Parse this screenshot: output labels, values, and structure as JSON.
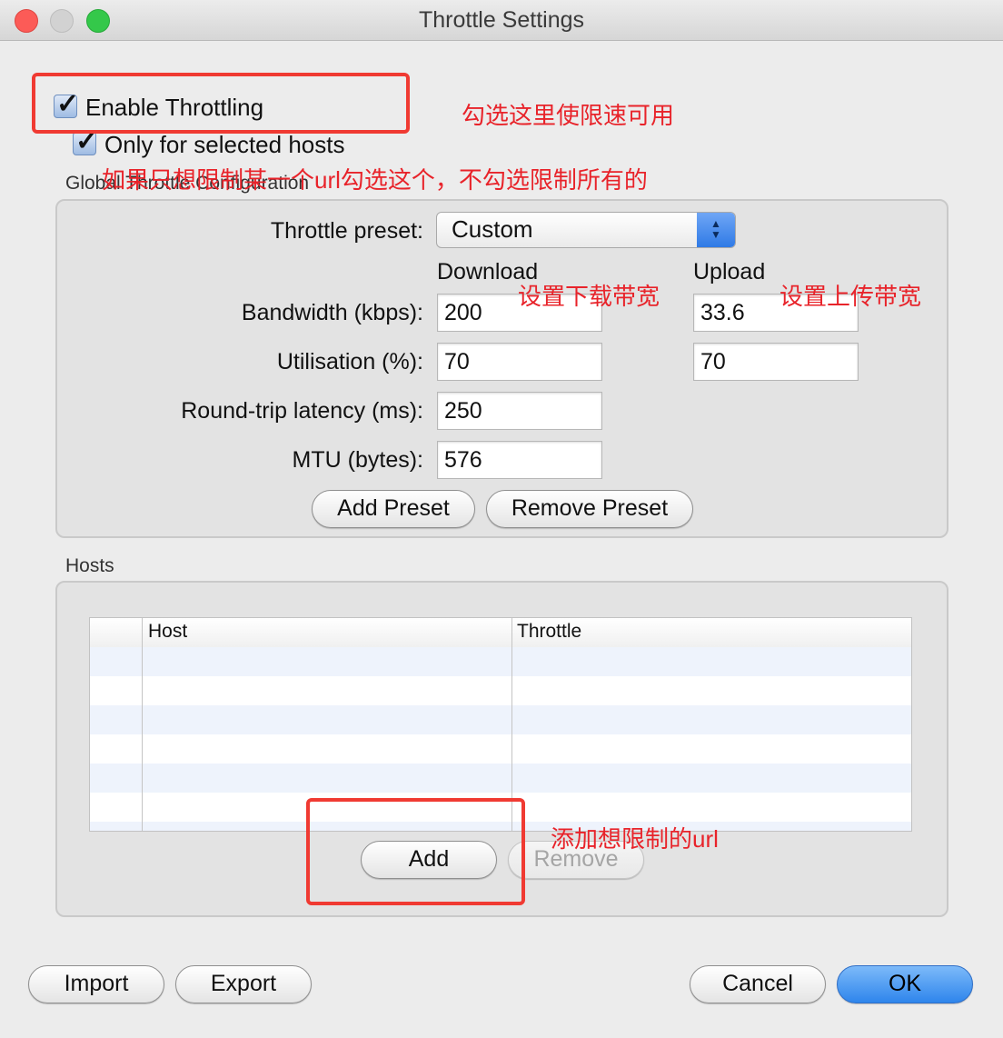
{
  "window": {
    "title": "Throttle Settings"
  },
  "checkboxes": {
    "enable_label": "Enable Throttling",
    "enable_checked": true,
    "selected_hosts_label": "Only for selected hosts",
    "selected_hosts_checked": true
  },
  "global": {
    "group_label": "Global Throttle Configuration",
    "preset_label": "Throttle preset:",
    "preset_value": "Custom",
    "download_header": "Download",
    "upload_header": "Upload",
    "bandwidth_label": "Bandwidth (kbps):",
    "bandwidth_download": "200",
    "bandwidth_upload": "33.6",
    "utilisation_label": "Utilisation (%):",
    "utilisation_download": "70",
    "utilisation_upload": "70",
    "latency_label": "Round-trip latency (ms):",
    "latency_value": "250",
    "mtu_label": "MTU (bytes):",
    "mtu_value": "576",
    "add_preset": "Add Preset",
    "remove_preset": "Remove Preset"
  },
  "hosts": {
    "group_label": "Hosts",
    "columns": [
      "",
      "Host",
      "Throttle"
    ],
    "add": "Add",
    "remove": "Remove"
  },
  "footer": {
    "import": "Import",
    "export": "Export",
    "cancel": "Cancel",
    "ok": "OK"
  },
  "annotations": {
    "enable": "勾选这里使限速可用",
    "selected_hosts": "如果只想限制某一个url勾选这个，不勾选限制所有的",
    "download": "设置下载带宽",
    "upload": "设置上传带宽",
    "add_url": "添加想限制的url"
  },
  "colors": {
    "annotation": "#e8232a",
    "primary_button": "#2e85ec"
  }
}
